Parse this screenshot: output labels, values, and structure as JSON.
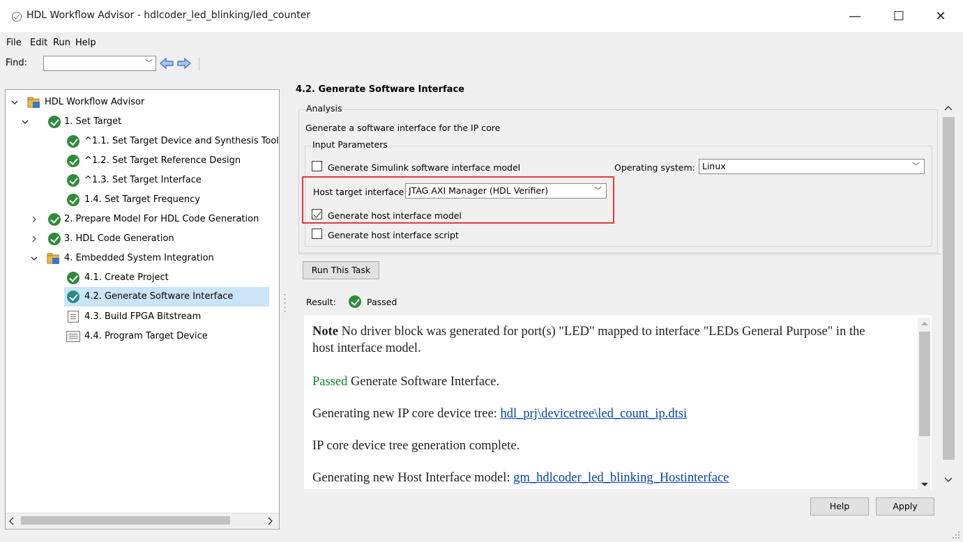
{
  "window": {
    "title": "HDL Workflow Advisor - hdlcoder_led_blinking/led_counter",
    "minimize": "—",
    "maximize": "☐",
    "close": "✕"
  },
  "menubar": {
    "items": [
      "File",
      "Edit",
      "Run",
      "Help"
    ]
  },
  "findbar": {
    "label": "Find:",
    "value": ""
  },
  "tree": {
    "items": [
      {
        "label": "HDL Workflow Advisor",
        "icon": "folder-icon",
        "level": 0,
        "expanded": true
      },
      {
        "label": "1. Set Target",
        "icon": "check-icon",
        "level": 1,
        "expanded": true
      },
      {
        "label": "^1.1. Set Target Device and Synthesis Tool",
        "icon": "check-icon",
        "level": 2
      },
      {
        "label": "^1.2. Set Target Reference Design",
        "icon": "check-icon",
        "level": 2
      },
      {
        "label": "^1.3. Set Target Interface",
        "icon": "check-icon",
        "level": 2
      },
      {
        "label": "1.4. Set Target Frequency",
        "icon": "check-icon",
        "level": 2
      },
      {
        "label": "2. Prepare Model For HDL Code Generation",
        "icon": "check-icon",
        "level": 1,
        "expanded": false
      },
      {
        "label": "3. HDL Code Generation",
        "icon": "check-icon",
        "level": 1,
        "expanded": false
      },
      {
        "label": "4. Embedded System Integration",
        "icon": "folder-icon",
        "level": 1,
        "expanded": true
      },
      {
        "label": "4.1. Create Project",
        "icon": "check-icon",
        "level": 2
      },
      {
        "label": "4.2. Generate Software Interface",
        "icon": "check-icon",
        "level": 2,
        "selected": true
      },
      {
        "label": "4.3. Build FPGA Bitstream",
        "icon": "document-icon",
        "level": 2
      },
      {
        "label": "4.4. Program Target Device",
        "icon": "document-icon",
        "level": 2
      }
    ]
  },
  "task": {
    "title": "4.2. Generate Software Interface",
    "analysis_legend": "Analysis",
    "analysis_desc": "Generate a software interface for the IP core",
    "params_legend": "Input Parameters",
    "gen_simulink_label": "Generate Simulink software interface model",
    "gen_simulink_checked": false,
    "os_label": "Operating system:",
    "os_value": "Linux",
    "host_target_label": "Host target interface",
    "host_target_value": "JTAG AXI Manager (HDL Verifier)",
    "gen_host_model_label": "Generate host interface model",
    "gen_host_model_checked": true,
    "gen_host_script_label": "Generate host interface script",
    "gen_host_script_checked": false,
    "run_button": "Run This Task",
    "result_label": "Result:",
    "result_value": "Passed"
  },
  "report": {
    "note_bold": "Note",
    "note_text": " No driver block was generated for port(s) \"LED\" mapped to interface \"LEDs General Purpose\" in the host interface model.",
    "passed_word": "Passed",
    "passed_text": " Generate Software Interface.",
    "devtree_text": "Generating new IP core device tree: ",
    "devtree_link": "hdl_prj\\devicetree\\led_count_ip.dtsi",
    "devtree_done": "IP core device tree generation complete.",
    "hostif_text": "Generating new Host Interface model: ",
    "hostif_link": "gm_hdlcoder_led_blinking_Hostinterface"
  },
  "buttons": {
    "help": "Help",
    "apply": "Apply"
  },
  "colors": {
    "accent_check": "#2e8b3a",
    "highlight": "#e0393e",
    "selection": "#cce4f7",
    "link": "#0645ad",
    "passed": "#118b24"
  }
}
